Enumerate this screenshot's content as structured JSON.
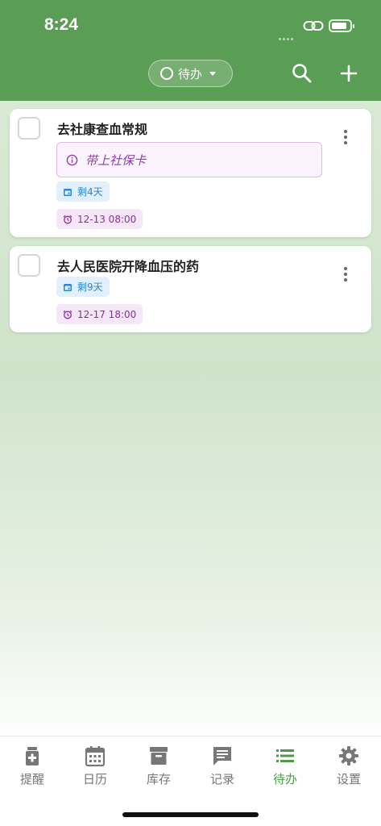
{
  "status_bar": {
    "time": "8:24"
  },
  "header": {
    "filter_label": "待办"
  },
  "tasks": [
    {
      "title": "去社康查血常规",
      "note": "带上社保卡",
      "remaining": "剩4天",
      "datetime": "12-13 08:00"
    },
    {
      "title": "去人民医院开降血压的药",
      "remaining": "剩9天",
      "datetime": "12-17 18:00"
    }
  ],
  "tabbar": {
    "items": [
      {
        "label": "提醒",
        "icon": "medicine-icon"
      },
      {
        "label": "日历",
        "icon": "calendar-icon"
      },
      {
        "label": "库存",
        "icon": "archive-icon"
      },
      {
        "label": "记录",
        "icon": "comment-icon"
      },
      {
        "label": "待办",
        "icon": "list-icon",
        "active": true
      },
      {
        "label": "设置",
        "icon": "gear-icon"
      }
    ]
  },
  "colors": {
    "header_green": "#5a9e55",
    "active_tab": "#4f9a4a",
    "note_purple": "#8e3fa6",
    "chip_blue": "#2a86d6"
  }
}
